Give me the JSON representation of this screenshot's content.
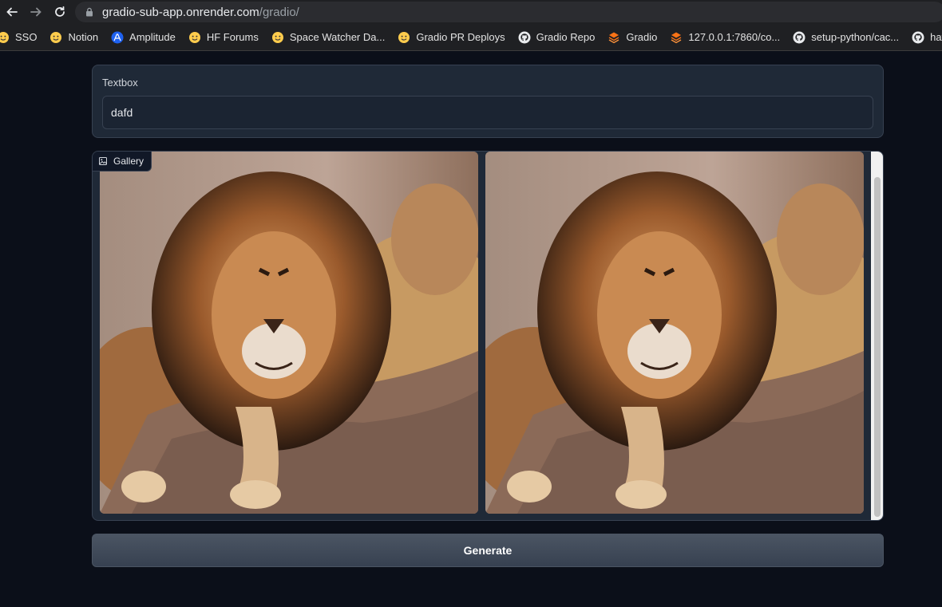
{
  "browser": {
    "url_host": "gradio-sub-app.onrender.com",
    "url_path": "/gradio/",
    "bookmarks": [
      {
        "label": "SSO",
        "icon": "hugging-face-icon"
      },
      {
        "label": "Notion",
        "icon": "hugging-face-icon"
      },
      {
        "label": "Amplitude",
        "icon": "amplitude-icon"
      },
      {
        "label": "HF Forums",
        "icon": "hugging-face-icon"
      },
      {
        "label": "Space Watcher Da...",
        "icon": "hugging-face-icon"
      },
      {
        "label": "Gradio PR Deploys",
        "icon": "hugging-face-icon"
      },
      {
        "label": "Gradio Repo",
        "icon": "github-icon"
      },
      {
        "label": "Gradio",
        "icon": "gradio-icon"
      },
      {
        "label": "127.0.0.1:7860/co...",
        "icon": "gradio-icon"
      },
      {
        "label": "setup-python/cac...",
        "icon": "github-icon"
      },
      {
        "label": "hatc",
        "icon": "github-icon"
      }
    ]
  },
  "textbox": {
    "label": "Textbox",
    "value": "dafd"
  },
  "gallery": {
    "label": "Gallery",
    "images": [
      {
        "subject": "lion"
      },
      {
        "subject": "lion"
      }
    ]
  },
  "generate": {
    "label": "Generate"
  },
  "colors": {
    "app_background": "#0b0f19",
    "block_background": "#1f2937",
    "border": "#374151",
    "button": "#4b5563"
  }
}
